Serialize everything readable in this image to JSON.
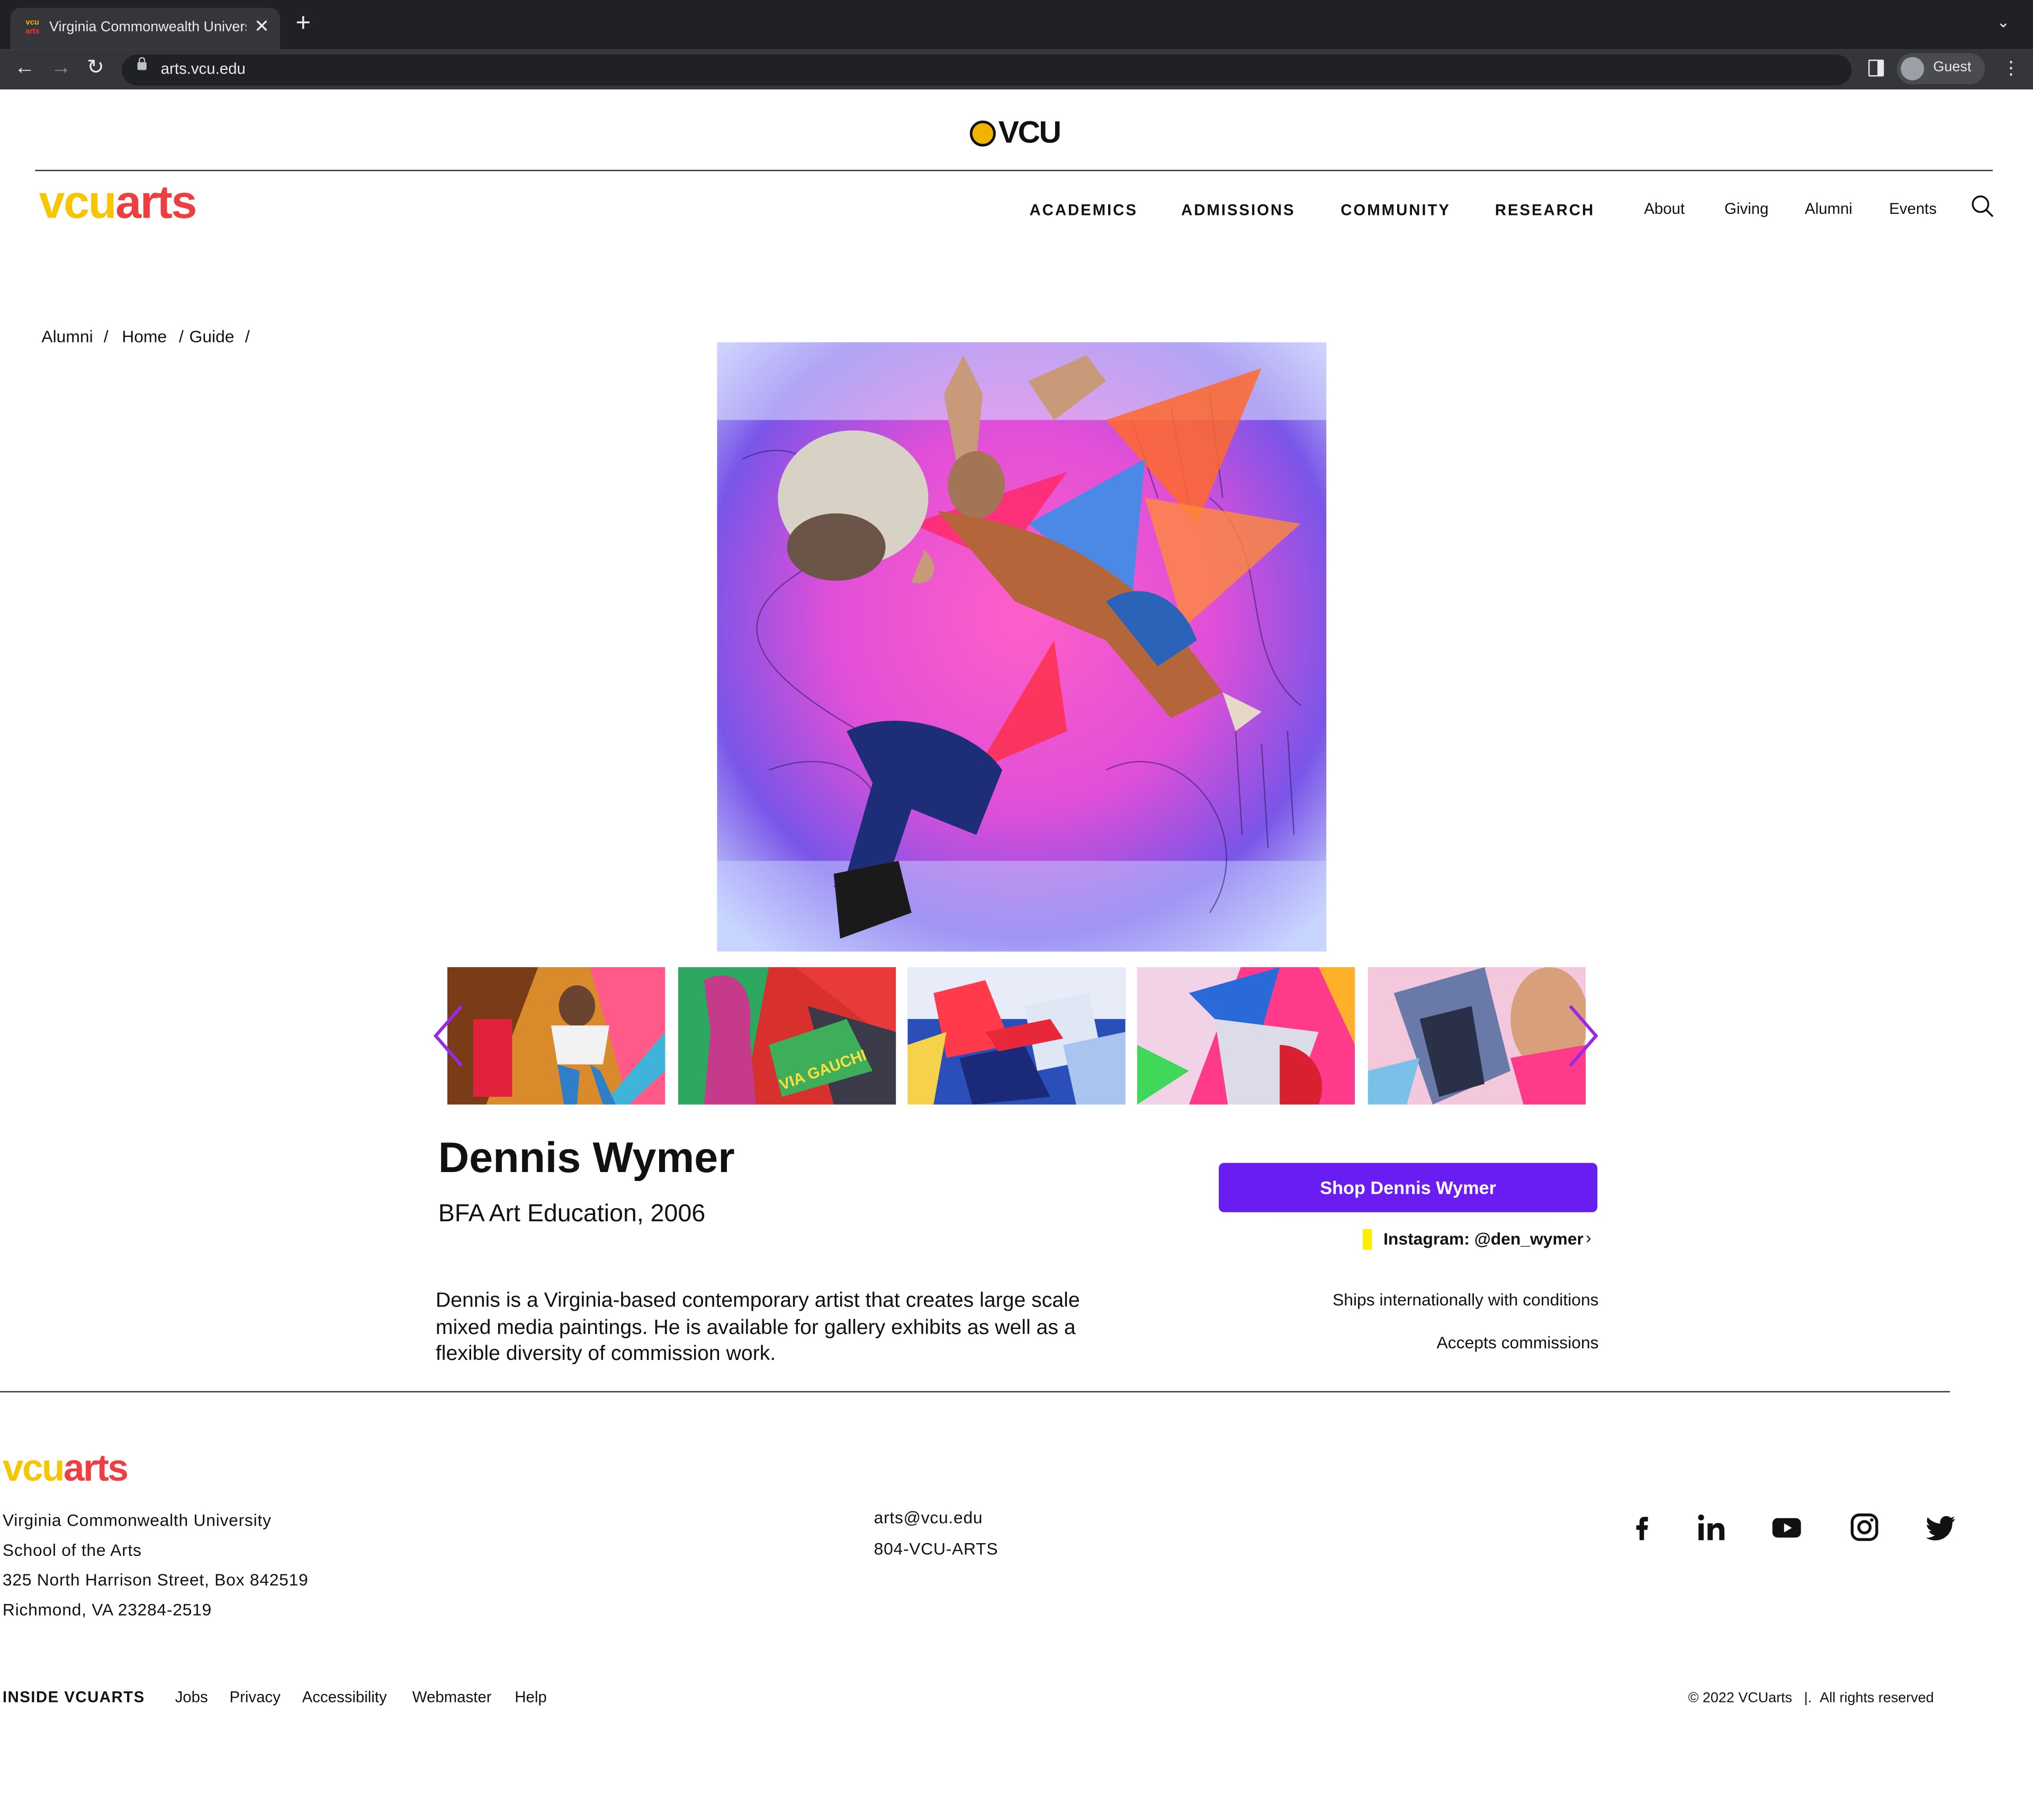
{
  "browser": {
    "tab_title": "Virginia Commonwealth University",
    "favicon_top": "vcu",
    "favicon_bottom": "arts",
    "url": "arts.vcu.edu",
    "profile": "Guest"
  },
  "header": {
    "university_wordmark": "VCU",
    "logo_vcu": "vcu",
    "logo_arts": "arts",
    "main_nav": [
      "ACADEMICS",
      "ADMISSIONS",
      "COMMUNITY",
      "RESEARCH"
    ],
    "sub_nav": [
      "About",
      "Giving",
      "Alumni",
      "Events"
    ]
  },
  "breadcrumb": {
    "items": [
      "Alumni",
      "Home",
      "Guide"
    ],
    "separator": "/"
  },
  "artist": {
    "name": "Dennis Wymer",
    "degree": "BFA Art Education, 2006",
    "bio": "Dennis is a Virginia-based contemporary artist that creates large scale mixed media paintings. He is available for gallery exhibits as well as a flexible diversity of commission work.",
    "shop_button": "Shop Dennis Wymer",
    "instagram": "Instagram: @den_wymer",
    "ships": "Ships internationally with conditions",
    "commissions": "Accepts commissions"
  },
  "gallery": {
    "thumb_count": 5,
    "thumb4_text": "VIA GAUCHI"
  },
  "footer": {
    "logo_vcu": "vcu",
    "logo_arts": "arts",
    "address": [
      "Virginia Commonwealth University",
      "School of the Arts",
      "325 North Harrison Street, Box 842519",
      "Richmond, VA 23284-2519"
    ],
    "email": "arts@vcu.edu",
    "phone": "804-VCU-ARTS",
    "social_icons": [
      "facebook-icon",
      "linkedin-icon",
      "youtube-icon",
      "instagram-icon",
      "twitter-icon"
    ],
    "inside_label": "INSIDE VCUARTS",
    "links": [
      "Jobs",
      "Privacy",
      "Accessibility",
      "Webmaster",
      "Help"
    ],
    "copyright": "© 2022 VCUarts",
    "rights_separator": "|.",
    "rights": "All rights reserved"
  },
  "colors": {
    "accent_purple": "#6a1df2",
    "logo_yellow": "#f7c600",
    "logo_red": "#ef3e42",
    "instagram_marker": "#ffee00"
  }
}
